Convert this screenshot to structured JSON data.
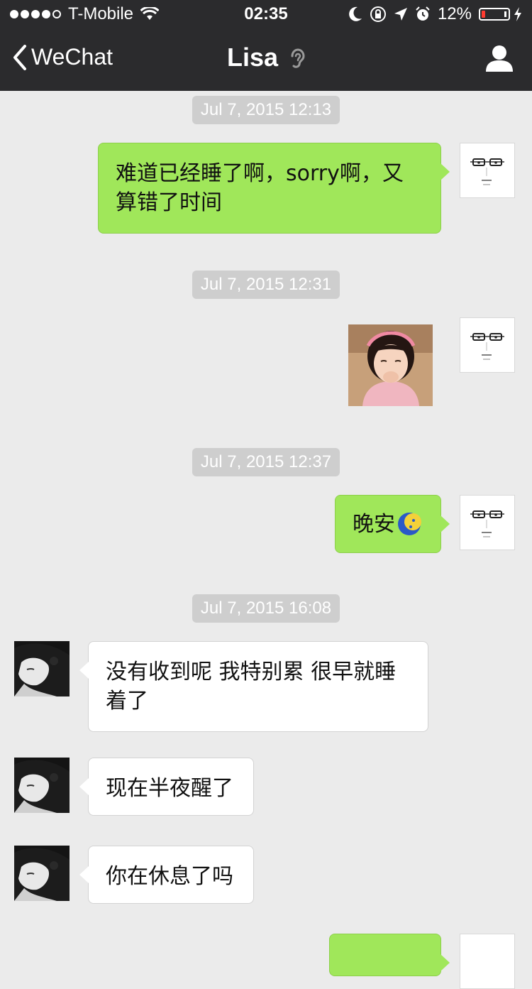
{
  "status_bar": {
    "carrier": "T-Mobile",
    "time": "02:35",
    "battery_percent": "12%",
    "battery_level": 0.12,
    "icons": [
      "signal-dots-icon",
      "wifi-icon",
      "moon-icon",
      "rotation-lock-icon",
      "location-arrow-icon",
      "alarm-icon",
      "battery-icon",
      "charging-bolt-icon"
    ]
  },
  "nav": {
    "back_label": "WeChat",
    "title": "Lisa",
    "title_icon": "ear-icon",
    "right_icon": "person-icon"
  },
  "colors": {
    "nav_bg": "#2b2b2d",
    "chat_bg": "#ebebeb",
    "sent_bubble": "#a0e75a",
    "received_bubble": "#ffffff",
    "timestamp_bg": "#cecece"
  },
  "messages": {
    "ts1": "Jul 7, 2015 12:13",
    "m1": "难道已经睡了啊，sorry啊，又算错了时间",
    "ts2": "Jul 7, 2015 12:31",
    "m2_image": "photo of little girl",
    "ts3": "Jul 7, 2015 12:37",
    "m3": "晚安",
    "m3_emoji": "moon-emoji-icon",
    "ts4": "Jul 7, 2015 16:08",
    "m4": "没有收到呢 我特别累 很早就睡着了",
    "m5": "现在半夜醒了",
    "m6": "你在休息了吗"
  }
}
